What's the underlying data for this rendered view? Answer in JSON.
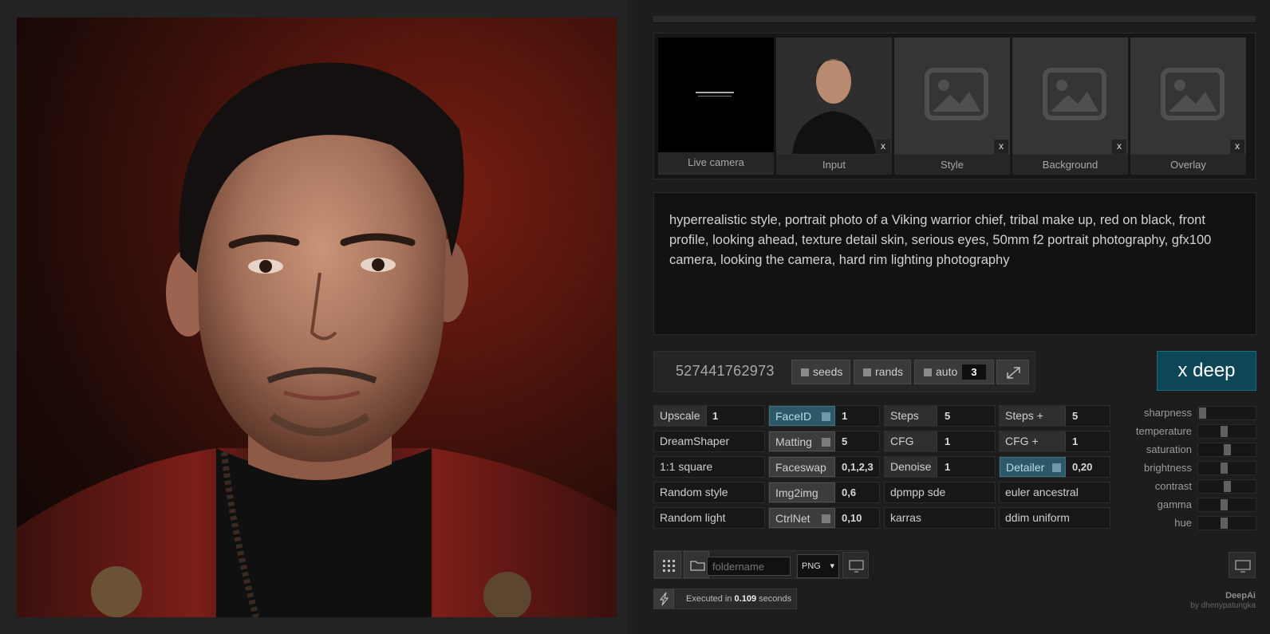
{
  "thumbnails": [
    {
      "caption": "Live camera",
      "close": ""
    },
    {
      "caption": "Input",
      "close": "x"
    },
    {
      "caption": "Style",
      "close": "x"
    },
    {
      "caption": "Background",
      "close": "x"
    },
    {
      "caption": "Overlay",
      "close": "x"
    }
  ],
  "prompt": "hyperrealistic style, portrait photo of a Viking warrior chief, tribal make up, red on black, front profile, looking ahead, texture detail skin, serious eyes, 50mm f2 portrait photography, gfx100 camera, looking the camera, hard rim lighting photography",
  "seed": {
    "value": "527441762973",
    "seeds_label": "seeds",
    "rands_label": "rands",
    "auto_label": "auto",
    "auto_count": "3"
  },
  "generate_button": {
    "icon": "x",
    "label": "deep"
  },
  "grid": {
    "col1": [
      {
        "label": "Upscale",
        "value": "1"
      },
      {
        "label": "DreamShaper"
      },
      {
        "label": "1:1 square"
      },
      {
        "label": "Random style"
      },
      {
        "label": "Random light"
      }
    ],
    "col2": [
      {
        "label": "FaceID",
        "value": "1"
      },
      {
        "label": "Matting",
        "value": "5"
      },
      {
        "label": "Faceswap",
        "value": "0,1,2,3"
      },
      {
        "label": "Img2img",
        "value": "0,6"
      },
      {
        "label": "CtrlNet",
        "value": "0,10"
      }
    ],
    "col3": [
      {
        "label": "Steps",
        "value": "5"
      },
      {
        "label": "CFG",
        "value": "1"
      },
      {
        "label": "Denoise",
        "value": "1"
      },
      {
        "label": "dpmpp sde"
      },
      {
        "label": "karras"
      }
    ],
    "col4": [
      {
        "label": "Steps +",
        "value": "5"
      },
      {
        "label": "CFG +",
        "value": "1"
      },
      {
        "label": "Detailer",
        "value": "0,20"
      },
      {
        "label": "euler ancestral"
      },
      {
        "label": "ddim uniform"
      }
    ]
  },
  "sliders": [
    {
      "label": "sharpness",
      "level": 0.02
    },
    {
      "label": "temperature",
      "level": 0.45
    },
    {
      "label": "saturation",
      "level": 0.5
    },
    {
      "label": "brightness",
      "level": 0.45
    },
    {
      "label": "contrast",
      "level": 0.5
    },
    {
      "label": "gamma",
      "level": 0.45
    },
    {
      "label": "hue",
      "level": 0.45
    }
  ],
  "output": {
    "folder_placeholder": "foldername",
    "format": "PNG"
  },
  "status": {
    "prefix": "Executed in",
    "time": "0.109",
    "suffix": "seconds"
  },
  "credit": {
    "brand": "DeepAi",
    "author": "by dhenypatungka"
  }
}
